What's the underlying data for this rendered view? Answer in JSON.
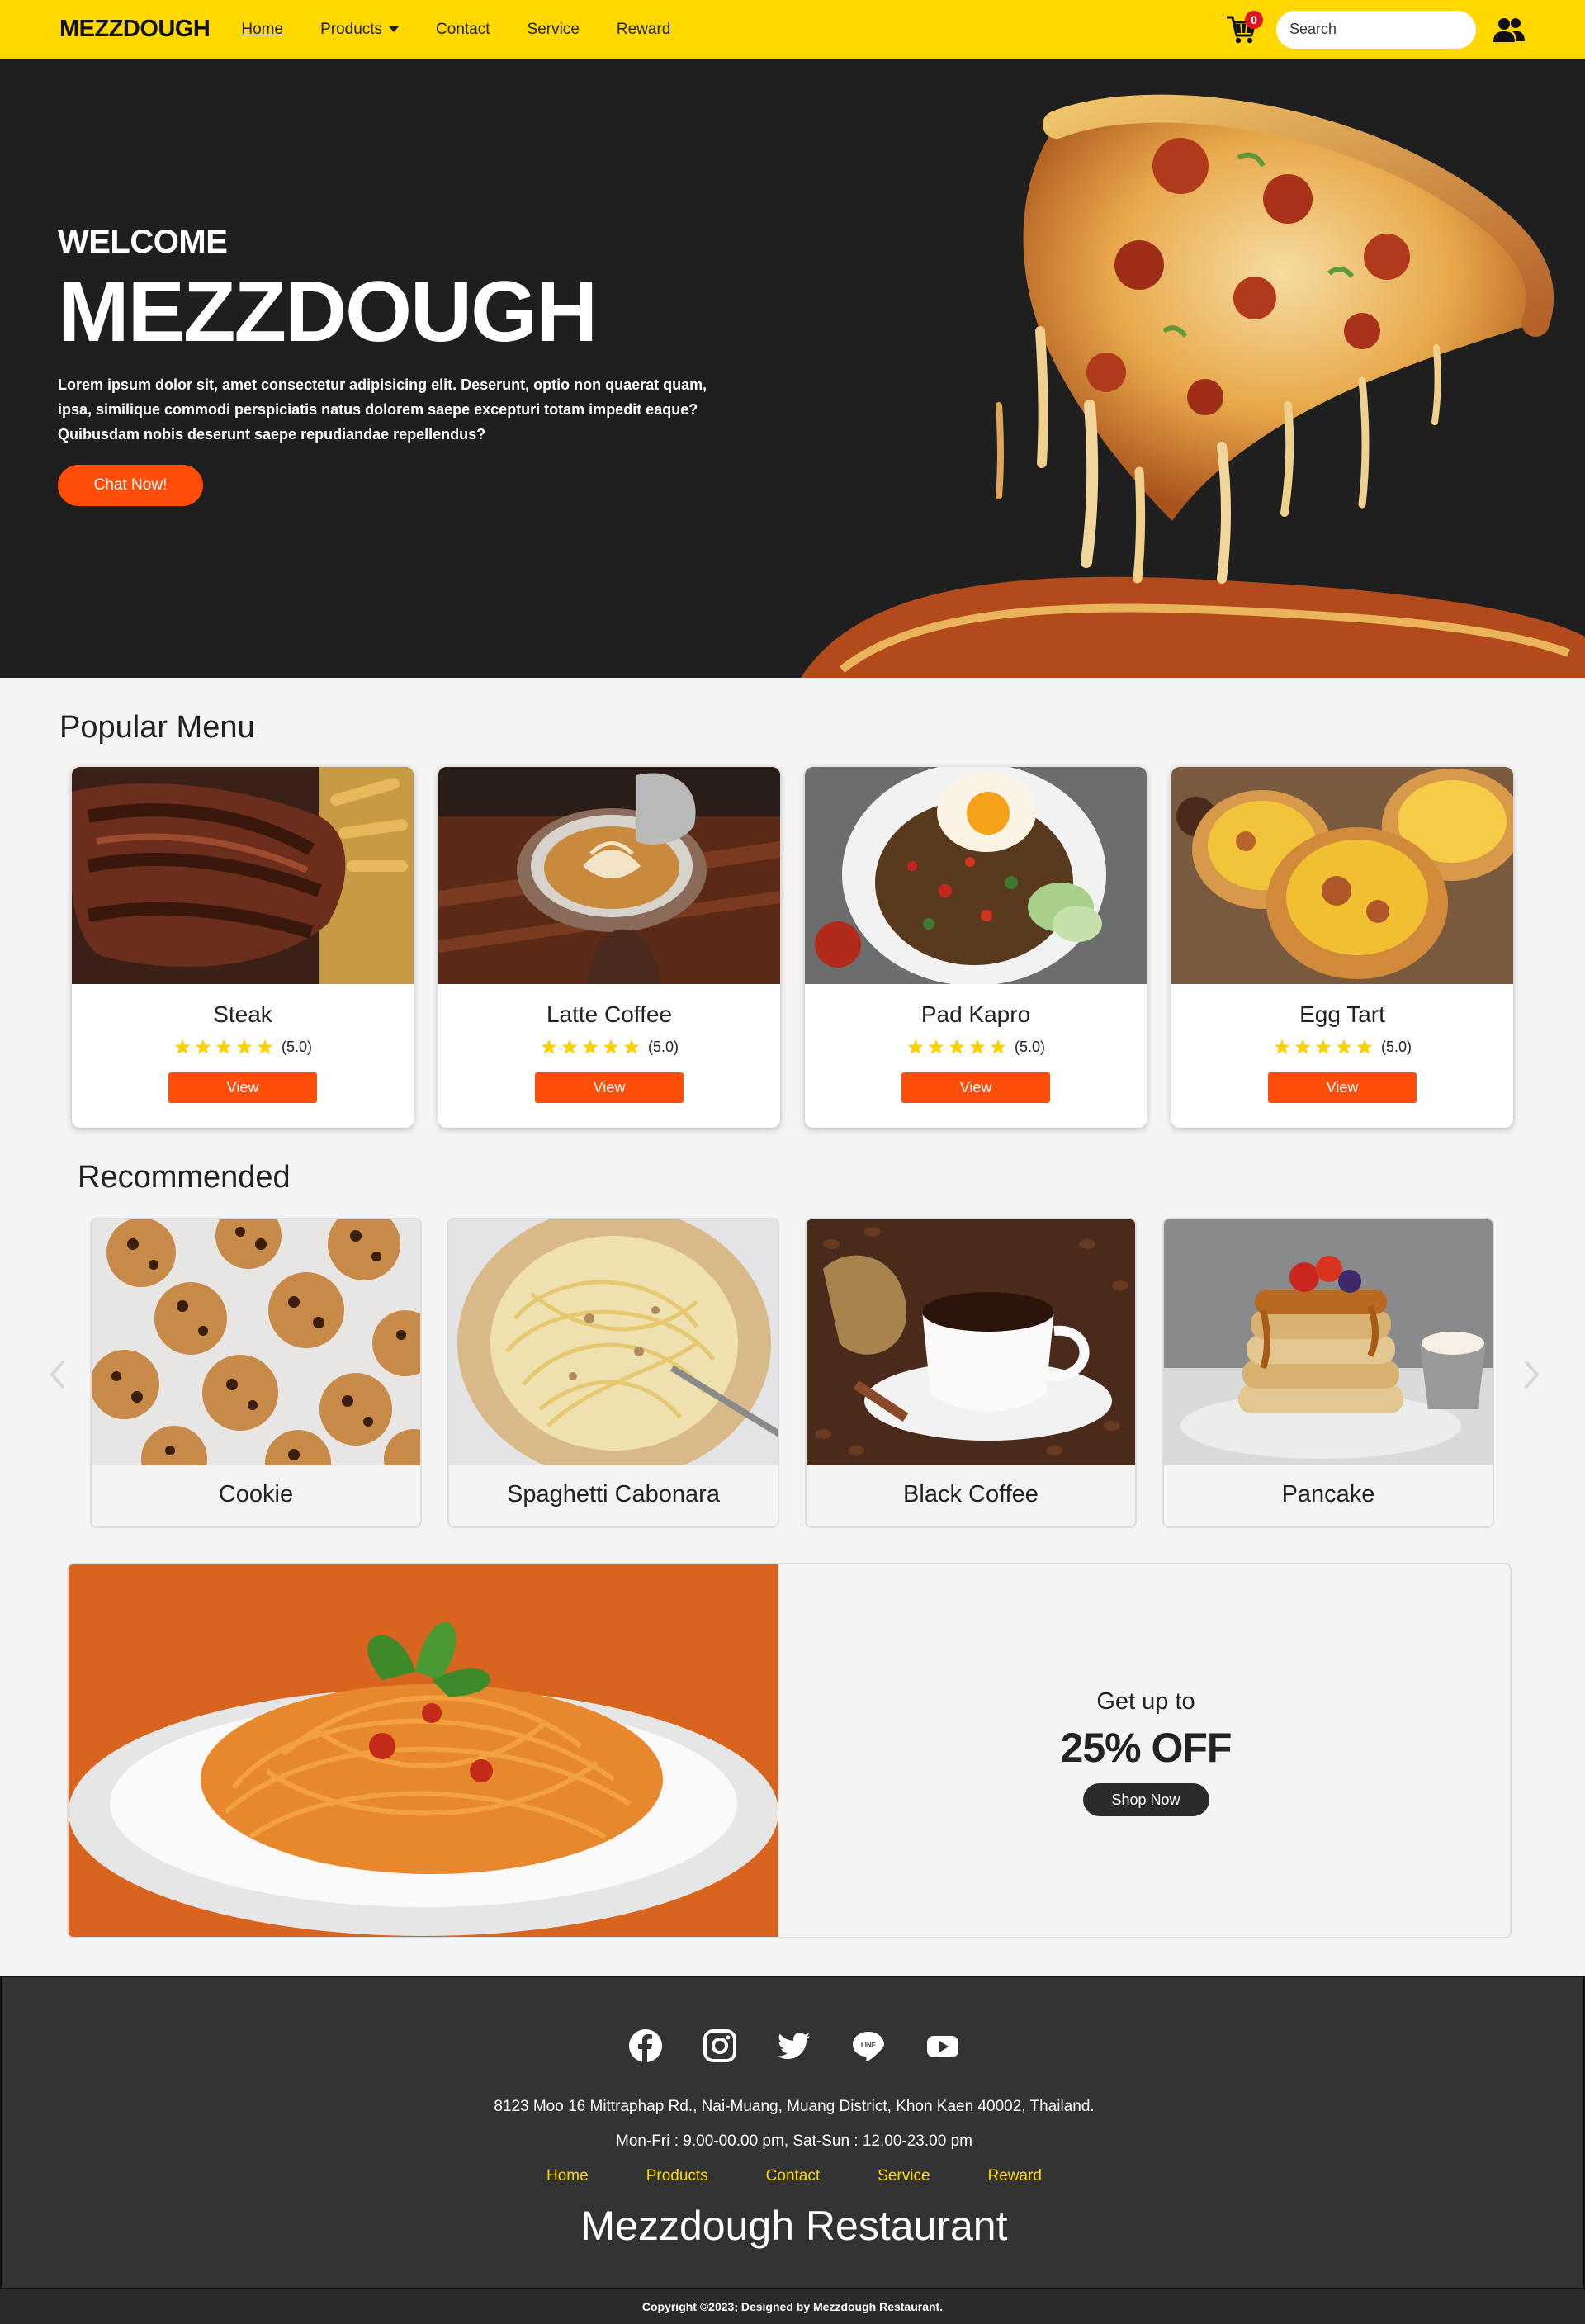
{
  "navbar": {
    "brand": "MEZZDOUGH",
    "links": [
      "Home",
      "Products",
      "Contact",
      "Service",
      "Reward"
    ],
    "cart_count": "0",
    "search_placeholder": "Search"
  },
  "hero": {
    "welcome": "WELCOME",
    "title": "MEZZDOUGH",
    "description": "Lorem ipsum dolor sit, amet consectetur adipisicing elit. Deserunt, optio non quaerat quam, ipsa, similique commodi perspiciatis natus dolorem saepe excepturi totam impedit eaque? Quibusdam nobis deserunt saepe repudiandae repellendus?",
    "cta": "Chat Now!"
  },
  "popular": {
    "title": "Popular Menu",
    "items": [
      {
        "name": "Steak",
        "rating": "(5.0)",
        "button": "View",
        "stars": 5
      },
      {
        "name": "Latte Coffee",
        "rating": "(5.0)",
        "button": "View",
        "stars": 5
      },
      {
        "name": "Pad Kapro",
        "rating": "(5.0)",
        "button": "View",
        "stars": 5
      },
      {
        "name": "Egg Tart",
        "rating": "(5.0)",
        "button": "View",
        "stars": 5
      }
    ]
  },
  "recommended": {
    "title": "Recommended",
    "items": [
      "Cookie",
      "Spaghetti Cabonara",
      "Black Coffee",
      "Pancake"
    ]
  },
  "promo": {
    "subtitle": "Get up to",
    "headline": "25% OFF",
    "button": "Shop Now"
  },
  "footer": {
    "socials": [
      "facebook-icon",
      "instagram-icon",
      "twitter-icon",
      "line-icon",
      "youtube-icon"
    ],
    "address": "8123 Moo 16 Mittraphap Rd., Nai-Muang, Muang District, Khon Kaen 40002, Thailand.",
    "hours": "Mon-Fri : 9.00-00.00 pm, Sat-Sun : 12.00-23.00 pm",
    "links": [
      "Home",
      "Products",
      "Contact",
      "Service",
      "Reward"
    ],
    "title": "Mezzdough Restaurant",
    "copyright": "Copyright ©2023; Designed by Mezzdough Restaurant."
  },
  "colors": {
    "navbar": "#ffd800",
    "accent": "#ff4d0a",
    "hero_bg": "#1f1f1f",
    "footer_bg": "#333333",
    "star": "#ffd000"
  }
}
